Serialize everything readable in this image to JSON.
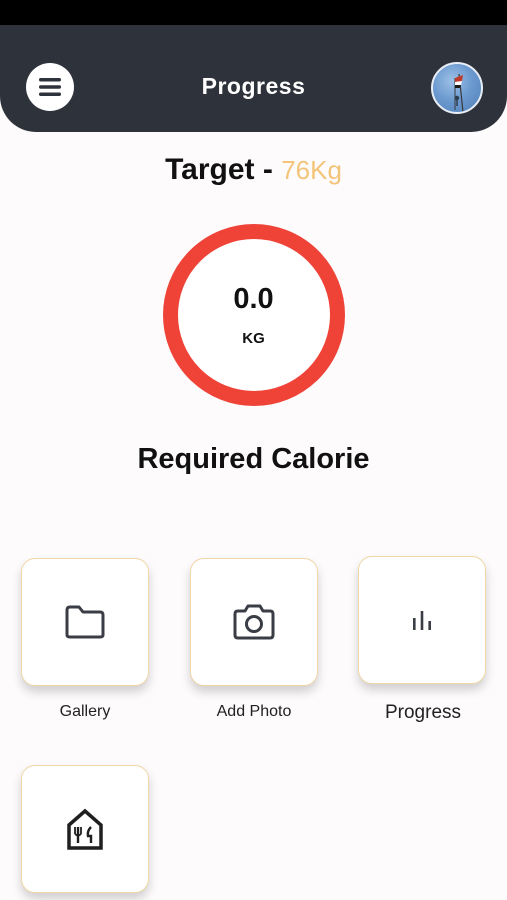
{
  "header": {
    "title": "Progress",
    "menu_icon": "hamburger-menu-icon",
    "avatar": "profile-avatar"
  },
  "target": {
    "label": "Target - ",
    "value": "76Kg"
  },
  "weight_ring": {
    "value": "0.0",
    "unit": "KG",
    "ring_color": "#ef4338"
  },
  "required_calorie": {
    "label": "Required Calorie"
  },
  "actions": [
    {
      "label": "Gallery",
      "icon": "folder-icon"
    },
    {
      "label": "Add Photo",
      "icon": "camera-icon"
    },
    {
      "label": "Progress",
      "icon": "bar-chart-icon"
    },
    {
      "label": "",
      "icon": "restaurant-icon"
    }
  ],
  "colors": {
    "header_bg": "#2e323b",
    "accent": "#f2c57a",
    "ring": "#ef4338",
    "tile_border": "#f1d7a6"
  }
}
